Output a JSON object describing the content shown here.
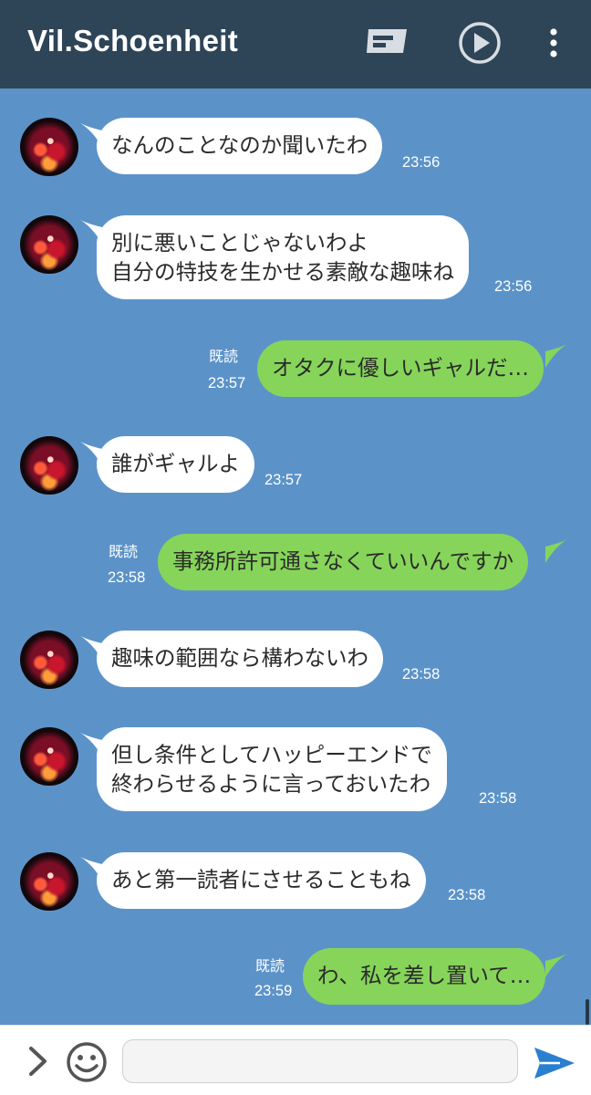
{
  "header": {
    "title": "Vil.Schoenheit",
    "icons": [
      "keyboard-icon",
      "play-icon",
      "more-vert-icon"
    ]
  },
  "messages": [
    {
      "side": "in",
      "lines": [
        "なんのことなのか聞いたわ"
      ],
      "time": "23:56"
    },
    {
      "side": "in",
      "lines": [
        "別に悪いことじゃないわよ",
        "自分の特技を生かせる素敵な趣味ね"
      ],
      "time": "23:56"
    },
    {
      "side": "out",
      "lines": [
        "オタクに優しいギャルだ…"
      ],
      "time": "23:57",
      "read": "既読"
    },
    {
      "side": "in",
      "lines": [
        "誰がギャルよ"
      ],
      "time": "23:57"
    },
    {
      "side": "out",
      "lines": [
        "事務所許可通さなくていいんですか"
      ],
      "time": "23:58",
      "read": "既読"
    },
    {
      "side": "in",
      "lines": [
        "趣味の範囲なら構わないわ"
      ],
      "time": "23:58"
    },
    {
      "side": "in",
      "lines": [
        "但し条件としてハッピーエンドで",
        "終わらせるように言っておいたわ"
      ],
      "time": "23:58"
    },
    {
      "side": "in",
      "lines": [
        "あと第一読者にさせることもね"
      ],
      "time": "23:58"
    },
    {
      "side": "out",
      "lines": [
        "わ、私を差し置いて…"
      ],
      "time": "23:59",
      "read": "既読"
    }
  ],
  "input": {
    "value": "",
    "placeholder": "",
    "icons": [
      "chevron-right-icon",
      "emoji-icon",
      "send-icon"
    ]
  },
  "colors": {
    "header_bg": "#2e4457",
    "chat_bg": "#5b93c9",
    "incoming_bubble": "#ffffff",
    "outgoing_bubble": "#86d55a",
    "send_icon": "#2a7fd0"
  }
}
